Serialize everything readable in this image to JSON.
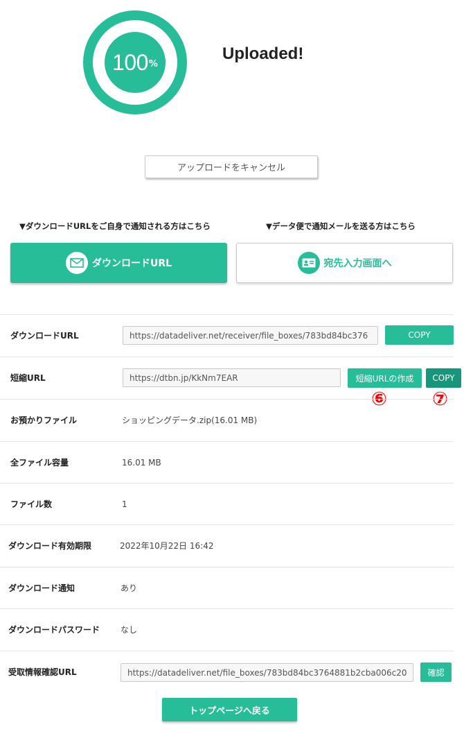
{
  "progress": {
    "number": "100",
    "unit": "%",
    "value": 100
  },
  "status_title": "Uploaded!",
  "cancel_label": "アップロードをキャンセル",
  "captions": {
    "left": "▼ダウンロードURLをご自身で通知される方はこちら",
    "right": "▼データ便で通知メールを送る方はこちら"
  },
  "buttons": {
    "download_url": {
      "label": "ダウンロードURL",
      "icon": "mail-icon"
    },
    "recipient": {
      "label": "宛先入力画面へ",
      "icon": "id-card-icon"
    },
    "back": "トップページへ戻る"
  },
  "details": {
    "download_url": {
      "label": "ダウンロードURL",
      "value": "https://datadeliver.net/receiver/file_boxes/783bd84bc376",
      "copy": "COPY"
    },
    "short_url": {
      "label": "短縮URL",
      "value": "https://dtbn.jp/KkNm7EAR",
      "create": "短縮URLの作成",
      "copy": "COPY"
    },
    "file": {
      "label": "お預かりファイル",
      "value": "ショッピングデータ.zip(16.01 MB)"
    },
    "total_size": {
      "label": "全ファイル容量",
      "value": "16.01 MB"
    },
    "file_count": {
      "label": "ファイル数",
      "value": "1"
    },
    "expiry": {
      "label": "ダウンロード有効期限",
      "value": "2022年10月22日 16:42"
    },
    "notify": {
      "label": "ダウンロード通知",
      "value": "あり"
    },
    "password": {
      "label": "ダウンロードパスワード",
      "value": "なし"
    },
    "receipt_url": {
      "label": "受取情報確認URL",
      "value": "https://datadeliver.net/file_boxes/783bd84bc3764881b2cba006c20",
      "confirm": "確認"
    }
  },
  "annotations": {
    "six": "⑥",
    "seven": "⑦"
  },
  "colors": {
    "accent": "#26bd98",
    "accent_dark": "#16967a",
    "annotation": "#ff0000"
  }
}
